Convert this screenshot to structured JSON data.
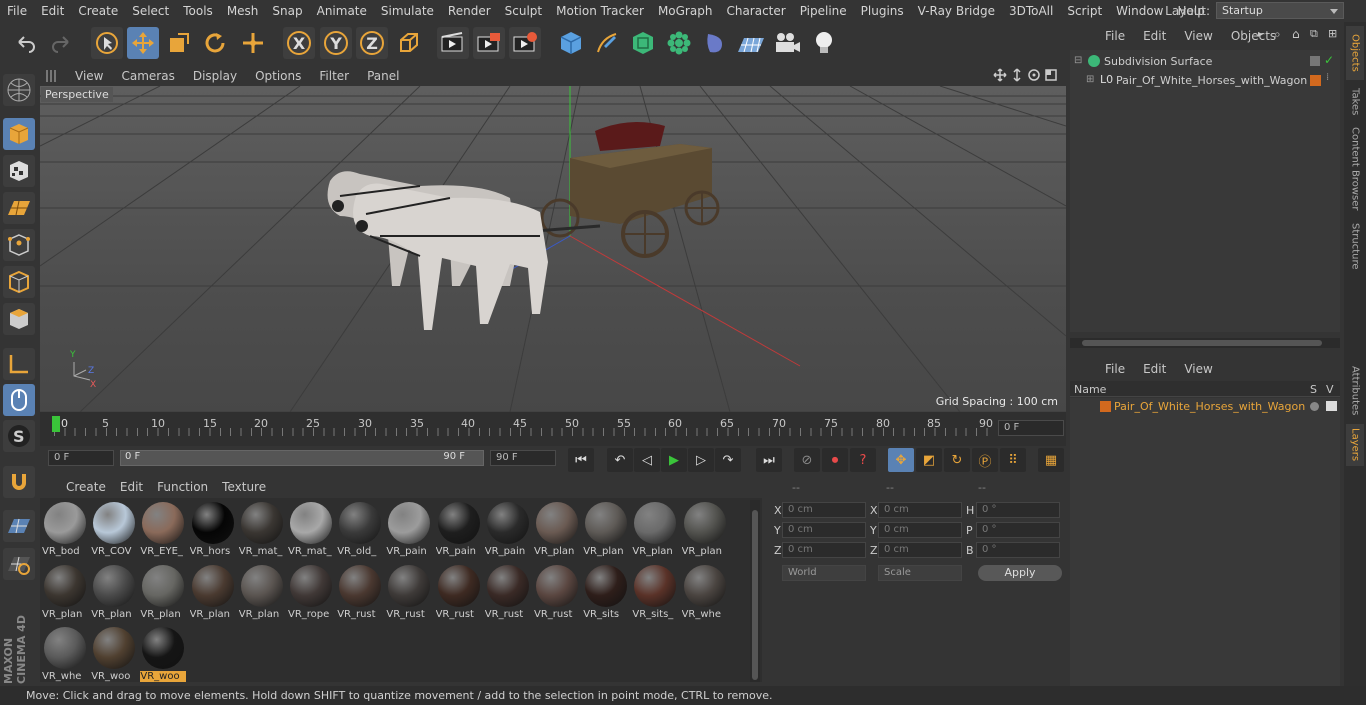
{
  "menu": [
    "File",
    "Edit",
    "Create",
    "Select",
    "Tools",
    "Mesh",
    "Snap",
    "Animate",
    "Simulate",
    "Render",
    "Sculpt",
    "Motion Tracker",
    "MoGraph",
    "Character",
    "Pipeline",
    "Plugins",
    "V-Ray Bridge",
    "3DToAll",
    "Script",
    "Window",
    "Help"
  ],
  "layout": {
    "label": "Layout:",
    "value": "Startup"
  },
  "toolbar": {
    "x": "X",
    "y": "Y",
    "z": "Z"
  },
  "viewport": {
    "menu": [
      "View",
      "Cameras",
      "Display",
      "Options",
      "Filter",
      "Panel"
    ],
    "label": "Perspective",
    "grid_spacing": "Grid Spacing : 100 cm",
    "axis_y": "Y",
    "axis_z": "Z",
    "axis_x": "X"
  },
  "timeline": {
    "ticks": [
      "0",
      "5",
      "10",
      "15",
      "20",
      "25",
      "30",
      "35",
      "40",
      "45",
      "50",
      "55",
      "60",
      "65",
      "70",
      "75",
      "80",
      "85",
      "90"
    ],
    "frame_field": "0 F"
  },
  "transport": {
    "start": "0 F",
    "range_start": "0 F",
    "range_end": "90 F",
    "end": "90 F"
  },
  "materials": {
    "menu": [
      "Create",
      "Edit",
      "Function",
      "Texture"
    ],
    "items": [
      "VR_bod",
      "VR_COV",
      "VR_EYE_",
      "VR_hors",
      "VR_mat_",
      "VR_mat_",
      "VR_old_",
      "VR_pain",
      "VR_pain",
      "VR_pain",
      "VR_plan",
      "VR_plan",
      "VR_plan",
      "VR_plan",
      "VR_plan",
      "VR_plan",
      "VR_plan",
      "VR_plan",
      "VR_plan",
      "VR_rope",
      "VR_rust",
      "VR_rust",
      "VR_rust",
      "VR_rust",
      "VR_rust",
      "VR_sits",
      "VR_sits_",
      "VR_whe",
      "VR_whe",
      "VR_woo",
      "VR_woo"
    ]
  },
  "coords": {
    "headers": [
      "--",
      "--",
      "--"
    ],
    "rows": [
      {
        "a": "X",
        "av": "0 cm",
        "b": "X",
        "bv": "0 cm",
        "c": "H",
        "cv": "0 °"
      },
      {
        "a": "Y",
        "av": "0 cm",
        "b": "Y",
        "bv": "0 cm",
        "c": "P",
        "cv": "0 °"
      },
      {
        "a": "Z",
        "av": "0 cm",
        "b": "Z",
        "bv": "0 cm",
        "c": "B",
        "cv": "0 °"
      }
    ],
    "world": "World",
    "scale": "Scale",
    "apply": "Apply"
  },
  "objects": {
    "menu": [
      "File",
      "Edit",
      "View",
      "Objects"
    ],
    "items": [
      "Subdivision Surface",
      "Pair_Of_White_Horses_with_Wagon"
    ]
  },
  "layers": {
    "menu": [
      "File",
      "Edit",
      "View"
    ],
    "col_name": "Name",
    "col_s": "S",
    "col_v": "V",
    "item": "Pair_Of_White_Horses_with_Wagon"
  },
  "side_tabs_top": [
    "Objects",
    "Takes",
    "Content Browser",
    "Structure"
  ],
  "side_tabs_bottom": [
    "Attributes",
    "Layers"
  ],
  "brand": "MAXON CINEMA 4D",
  "status": "Move: Click and drag to move elements. Hold down SHIFT to quantize movement / add to the selection in point mode, CTRL to remove.",
  "colors": {
    "accent": "#e8a53a",
    "active": "#5a82b4",
    "panel": "#343434"
  }
}
